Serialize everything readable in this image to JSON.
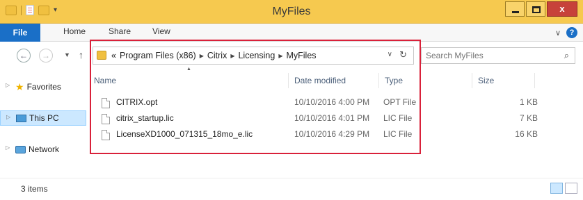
{
  "window": {
    "title": "MyFiles",
    "close_label": "x"
  },
  "ribbon": {
    "tabs": [
      "File",
      "Home",
      "Share",
      "View"
    ],
    "help_label": "?"
  },
  "address": {
    "crumbs": [
      "Program Files (x86)",
      "Citrix",
      "Licensing",
      "MyFiles"
    ],
    "prefix": "«"
  },
  "search": {
    "placeholder": "Search MyFiles"
  },
  "nav": {
    "items": [
      {
        "label": "Favorites",
        "icon": "star-icon"
      },
      {
        "label": "This PC",
        "icon": "computer-icon"
      },
      {
        "label": "Network",
        "icon": "network-icon"
      }
    ]
  },
  "columns": {
    "name": "Name",
    "date": "Date modified",
    "type": "Type",
    "size": "Size"
  },
  "files": [
    {
      "name": "CITRIX.opt",
      "date": "10/10/2016 4:00 PM",
      "type": "OPT File",
      "size": "1 KB"
    },
    {
      "name": "citrix_startup.lic",
      "date": "10/10/2016 4:01 PM",
      "type": "LIC File",
      "size": "7 KB"
    },
    {
      "name": "LicenseXD1000_071315_18mo_e.lic",
      "date": "10/10/2016 4:29 PM",
      "type": "LIC File",
      "size": "16 KB"
    }
  ],
  "status": {
    "item_count": "3 items"
  },
  "colors": {
    "highlight": "#d9213a",
    "accent": "#1a6fc7",
    "titlebar": "#f6c94f"
  }
}
